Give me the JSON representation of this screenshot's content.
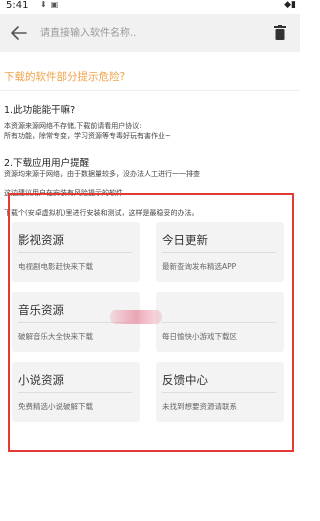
{
  "status_bar": {
    "time": "5:41",
    "icons": [
      "download-icon",
      "notification-icon"
    ],
    "right_icons": [
      "wifi-icon",
      "battery-icon"
    ]
  },
  "search": {
    "placeholder": "请直接输入软件名称.."
  },
  "notice": {
    "title": "下载的软件部分提示危险?",
    "sections": [
      {
        "heading": "1.此功能能干嘛?",
        "lines": [
          "本资源来源网络不存储,下载前请看用户协议:",
          "所有功能，除常专变，学习资源等专毒好玩有害作业~"
        ]
      },
      {
        "heading": "2.下载应用用户提醒",
        "lines": [
          "资源均来源于网络，由于数据量较多，没办法人工进行一一排查",
          "这边建议用户在安装有风险提示的软件",
          "下载个(安卓虚拟机)里进行安装和测试，这样是最稳妥的办法。"
        ]
      }
    ]
  },
  "cards": [
    {
      "title": "影视资源",
      "subtitle": "电视剧电影赶快来下载"
    },
    {
      "title": "今日更新",
      "subtitle": "最新查询发布精选APP"
    },
    {
      "title": "音乐资源",
      "subtitle": "破解音乐大全快来下载"
    },
    {
      "title": "",
      "subtitle": "每日愉快小游戏下载区"
    },
    {
      "title": "小说资源",
      "subtitle": "免费精选小说破解下载"
    },
    {
      "title": "反馈中心",
      "subtitle": "未找到想要资源请联系"
    }
  ],
  "colors": {
    "accent": "#f0a24a",
    "highlight_frame": "#e53935",
    "card_bg": "#f3f3f3",
    "searchbar_bg": "#f1f1f1"
  }
}
